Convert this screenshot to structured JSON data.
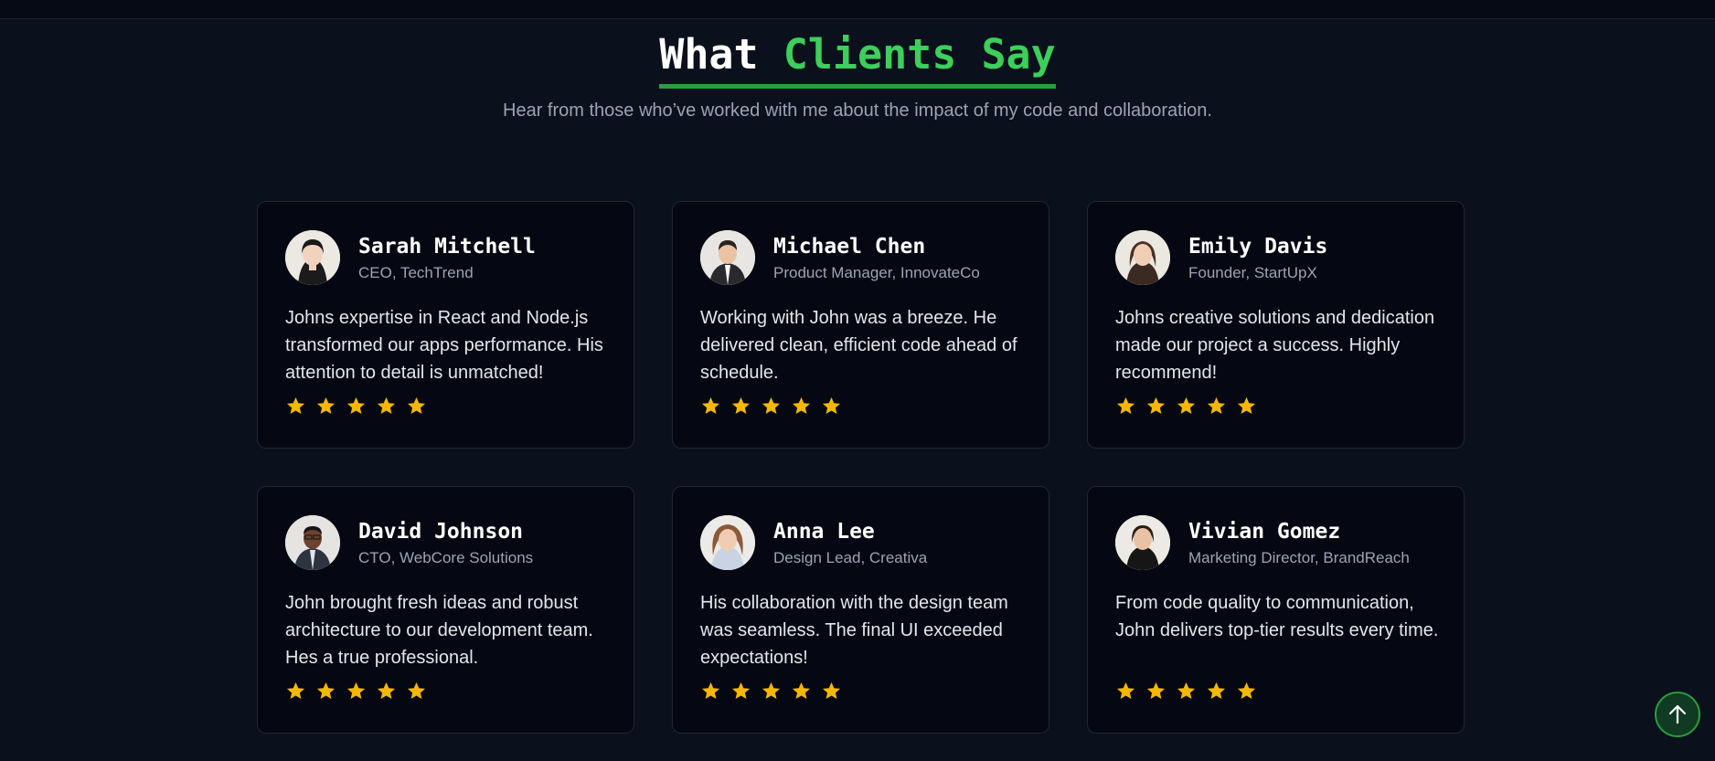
{
  "section": {
    "title_part1": "What",
    "title_part2": "Clients Say",
    "subtitle": "Hear from those who’ve worked with me about the impact of my code and collaboration."
  },
  "colors": {
    "accent": "#3ccf5a",
    "star": "#f5b800",
    "background": "#0b101d"
  },
  "testimonials": [
    {
      "name": "Sarah Mitchell",
      "role": "CEO, TechTrend",
      "quote": "Johns expertise in React and Node.js transformed our apps performance. His attention to detail is unmatched!",
      "rating": 5
    },
    {
      "name": "Michael Chen",
      "role": "Product Manager, InnovateCo",
      "quote": "Working with John was a breeze. He delivered clean, efficient code ahead of schedule.",
      "rating": 5
    },
    {
      "name": "Emily Davis",
      "role": "Founder, StartUpX",
      "quote": "Johns creative solutions and dedication made our project a success. Highly recommend!",
      "rating": 5
    },
    {
      "name": "David Johnson",
      "role": "CTO, WebCore Solutions",
      "quote": "John brought fresh ideas and robust architecture to our development team. Hes a true professional.",
      "rating": 5
    },
    {
      "name": "Anna Lee",
      "role": "Design Lead, Creativa",
      "quote": "His collaboration with the design team was seamless. The final UI exceeded expectations!",
      "rating": 5
    },
    {
      "name": "Vivian Gomez",
      "role": "Marketing Director, BrandReach",
      "quote": "From code quality to communication, John delivers top-tier results every time.",
      "rating": 5
    }
  ],
  "icons": {
    "star": "star-icon",
    "scroll_top": "arrow-up-icon",
    "avatar": "avatar-photo"
  }
}
